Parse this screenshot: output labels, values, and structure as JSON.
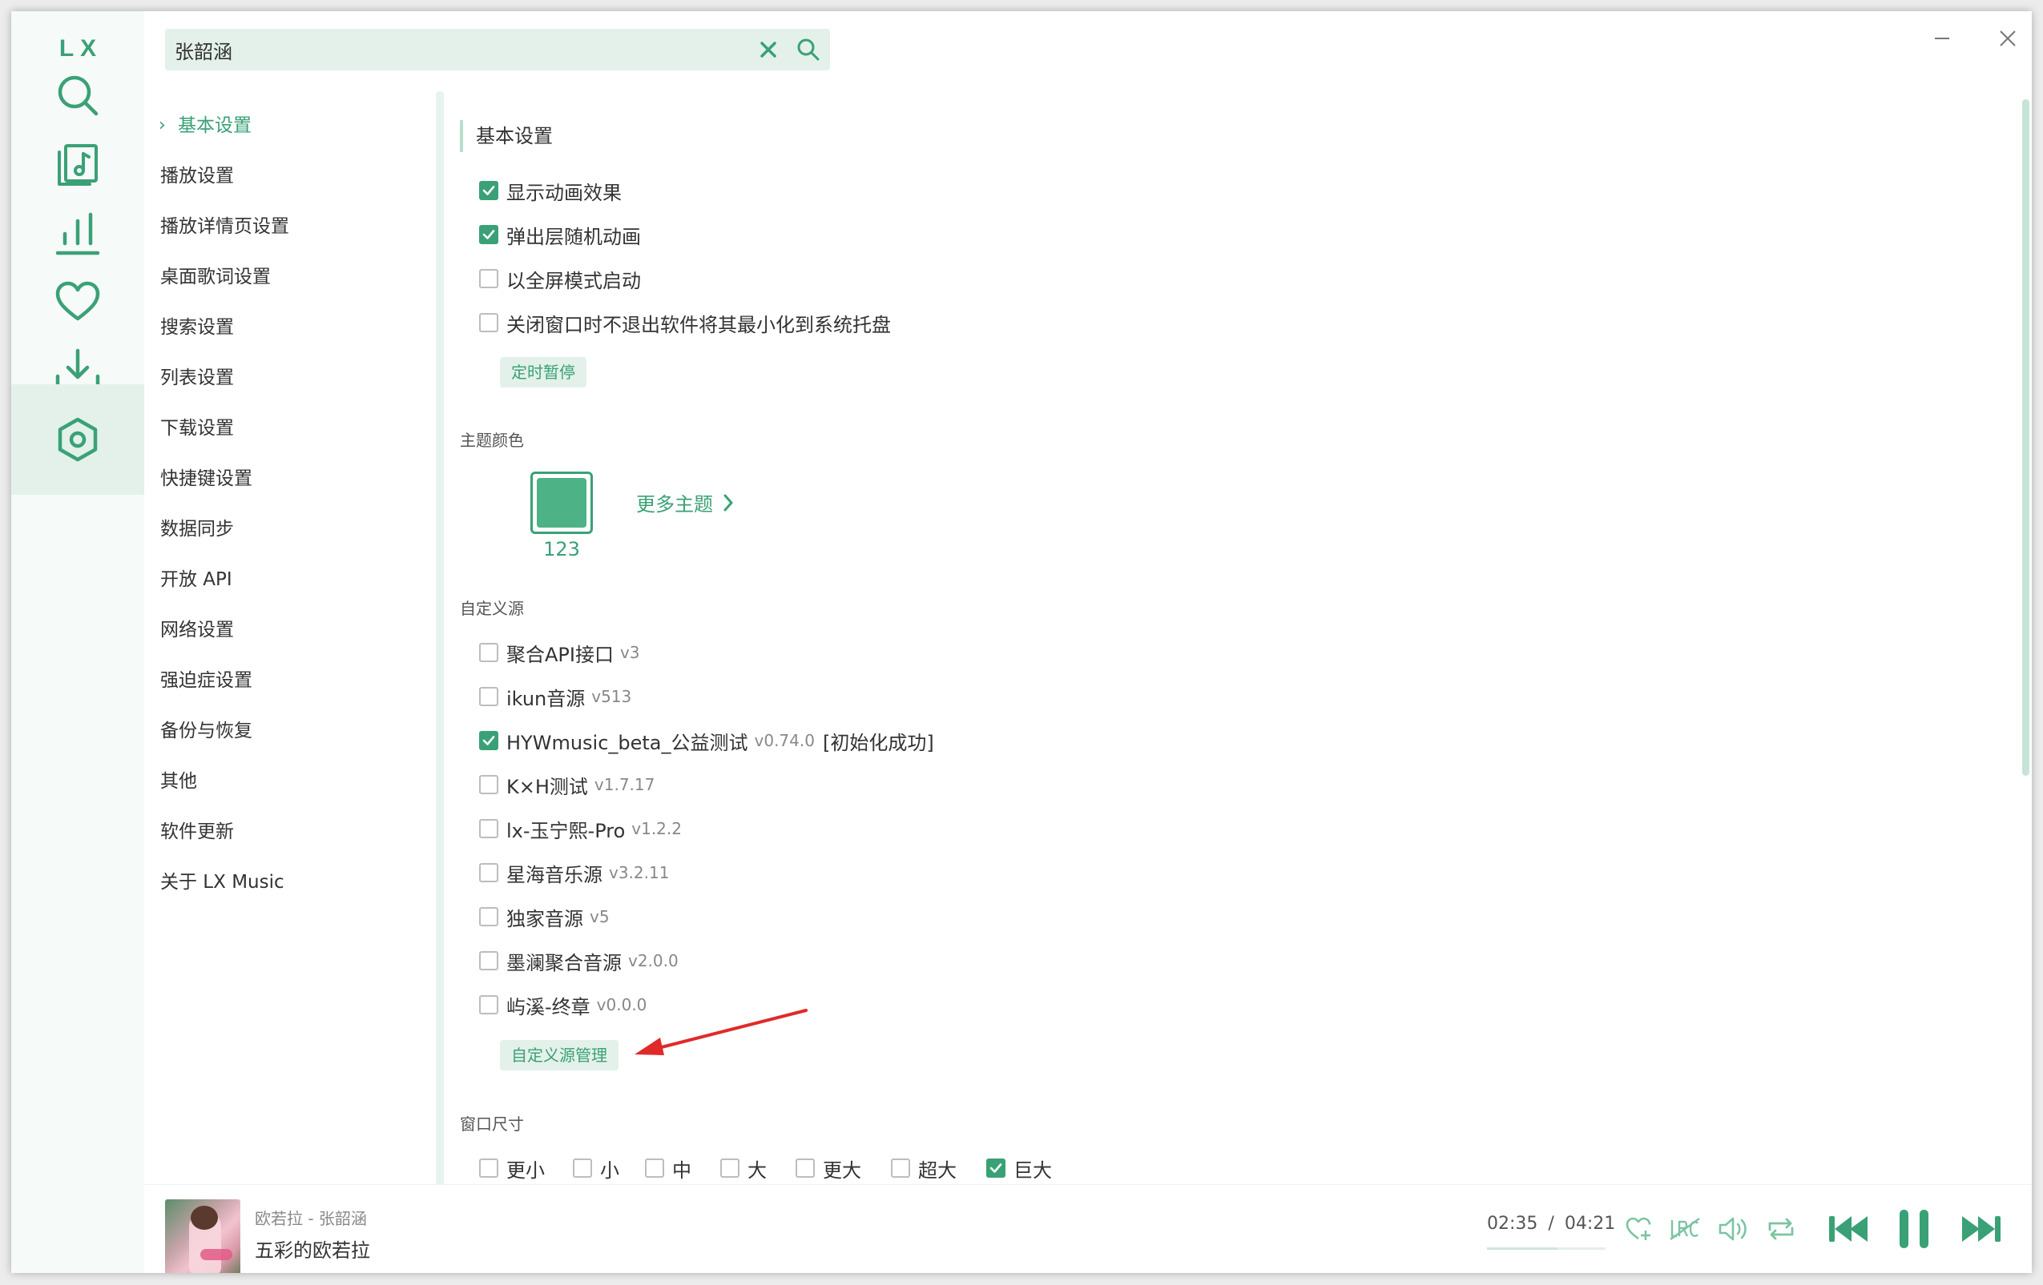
{
  "app": {
    "logo": "LX"
  },
  "search": {
    "value": "张韶涵",
    "placeholder": ""
  },
  "nav": {
    "items": [
      {
        "label": "基本设置",
        "active": true
      },
      {
        "label": "播放设置"
      },
      {
        "label": "播放详情页设置"
      },
      {
        "label": "桌面歌词设置"
      },
      {
        "label": "搜索设置"
      },
      {
        "label": "列表设置"
      },
      {
        "label": "下载设置"
      },
      {
        "label": "快捷键设置"
      },
      {
        "label": "数据同步"
      },
      {
        "label": "开放 API"
      },
      {
        "label": "网络设置"
      },
      {
        "label": "强迫症设置"
      },
      {
        "label": "备份与恢复"
      },
      {
        "label": "其他"
      },
      {
        "label": "软件更新"
      },
      {
        "label": "关于 LX Music"
      }
    ]
  },
  "basic": {
    "title": "基本设置",
    "options": [
      {
        "label": "显示动画效果",
        "checked": true
      },
      {
        "label": "弹出层随机动画",
        "checked": true
      },
      {
        "label": "以全屏模式启动",
        "checked": false
      },
      {
        "label": "关闭窗口时不退出软件将其最小化到系统托盘",
        "checked": false
      }
    ],
    "timer_button": "定时暂停"
  },
  "theme": {
    "title": "主题颜色",
    "current_name": "123",
    "current_color": "#4db286",
    "more_label": "更多主题"
  },
  "sources": {
    "title": "自定义源",
    "items": [
      {
        "name": "聚合API接口",
        "version": "v3",
        "checked": false
      },
      {
        "name": "ikun音源",
        "version": "v513",
        "checked": false
      },
      {
        "name": "HYWmusic_beta_公益测试",
        "version": "v0.74.0",
        "status": "[初始化成功]",
        "checked": true
      },
      {
        "name": "K×H测试",
        "version": "v1.7.17",
        "checked": false
      },
      {
        "name": "lx-玉宁熙-Pro",
        "version": "v1.2.2",
        "checked": false
      },
      {
        "name": "星海音乐源",
        "version": "v3.2.11",
        "checked": false
      },
      {
        "name": "独家音源",
        "version": "v5",
        "checked": false
      },
      {
        "name": "墨澜聚合音源",
        "version": "v2.0.0",
        "checked": false
      },
      {
        "name": "屿溪-终章",
        "version": "v0.0.0",
        "checked": false
      }
    ],
    "manage_button": "自定义源管理"
  },
  "window_size": {
    "title": "窗口尺寸",
    "options": [
      {
        "label": "更小",
        "checked": false
      },
      {
        "label": "小",
        "checked": false
      },
      {
        "label": "中",
        "checked": false
      },
      {
        "label": "大",
        "checked": false
      },
      {
        "label": "更大",
        "checked": false
      },
      {
        "label": "超大",
        "checked": false
      },
      {
        "label": "巨大",
        "checked": true
      }
    ]
  },
  "player": {
    "artist_line": "欧若拉 - 张韶涵",
    "title": "五彩的欧若拉",
    "current_time": "02:35",
    "separator": "/",
    "total_time": "04:21",
    "progress_fraction": 0.594
  },
  "colors": {
    "accent": "#3aa176",
    "accent_soft": "#e3f1ea",
    "annotation_arrow": "#e02a2a"
  },
  "icons": {
    "rail": [
      "search-icon",
      "music-list-icon",
      "leaderboard-icon",
      "heart-icon",
      "download-icon",
      "settings-hexagon-icon"
    ],
    "player": [
      "heart-add-icon",
      "lyric-icon",
      "volume-icon",
      "repeat-icon",
      "previous-icon",
      "pause-icon",
      "next-icon"
    ]
  }
}
